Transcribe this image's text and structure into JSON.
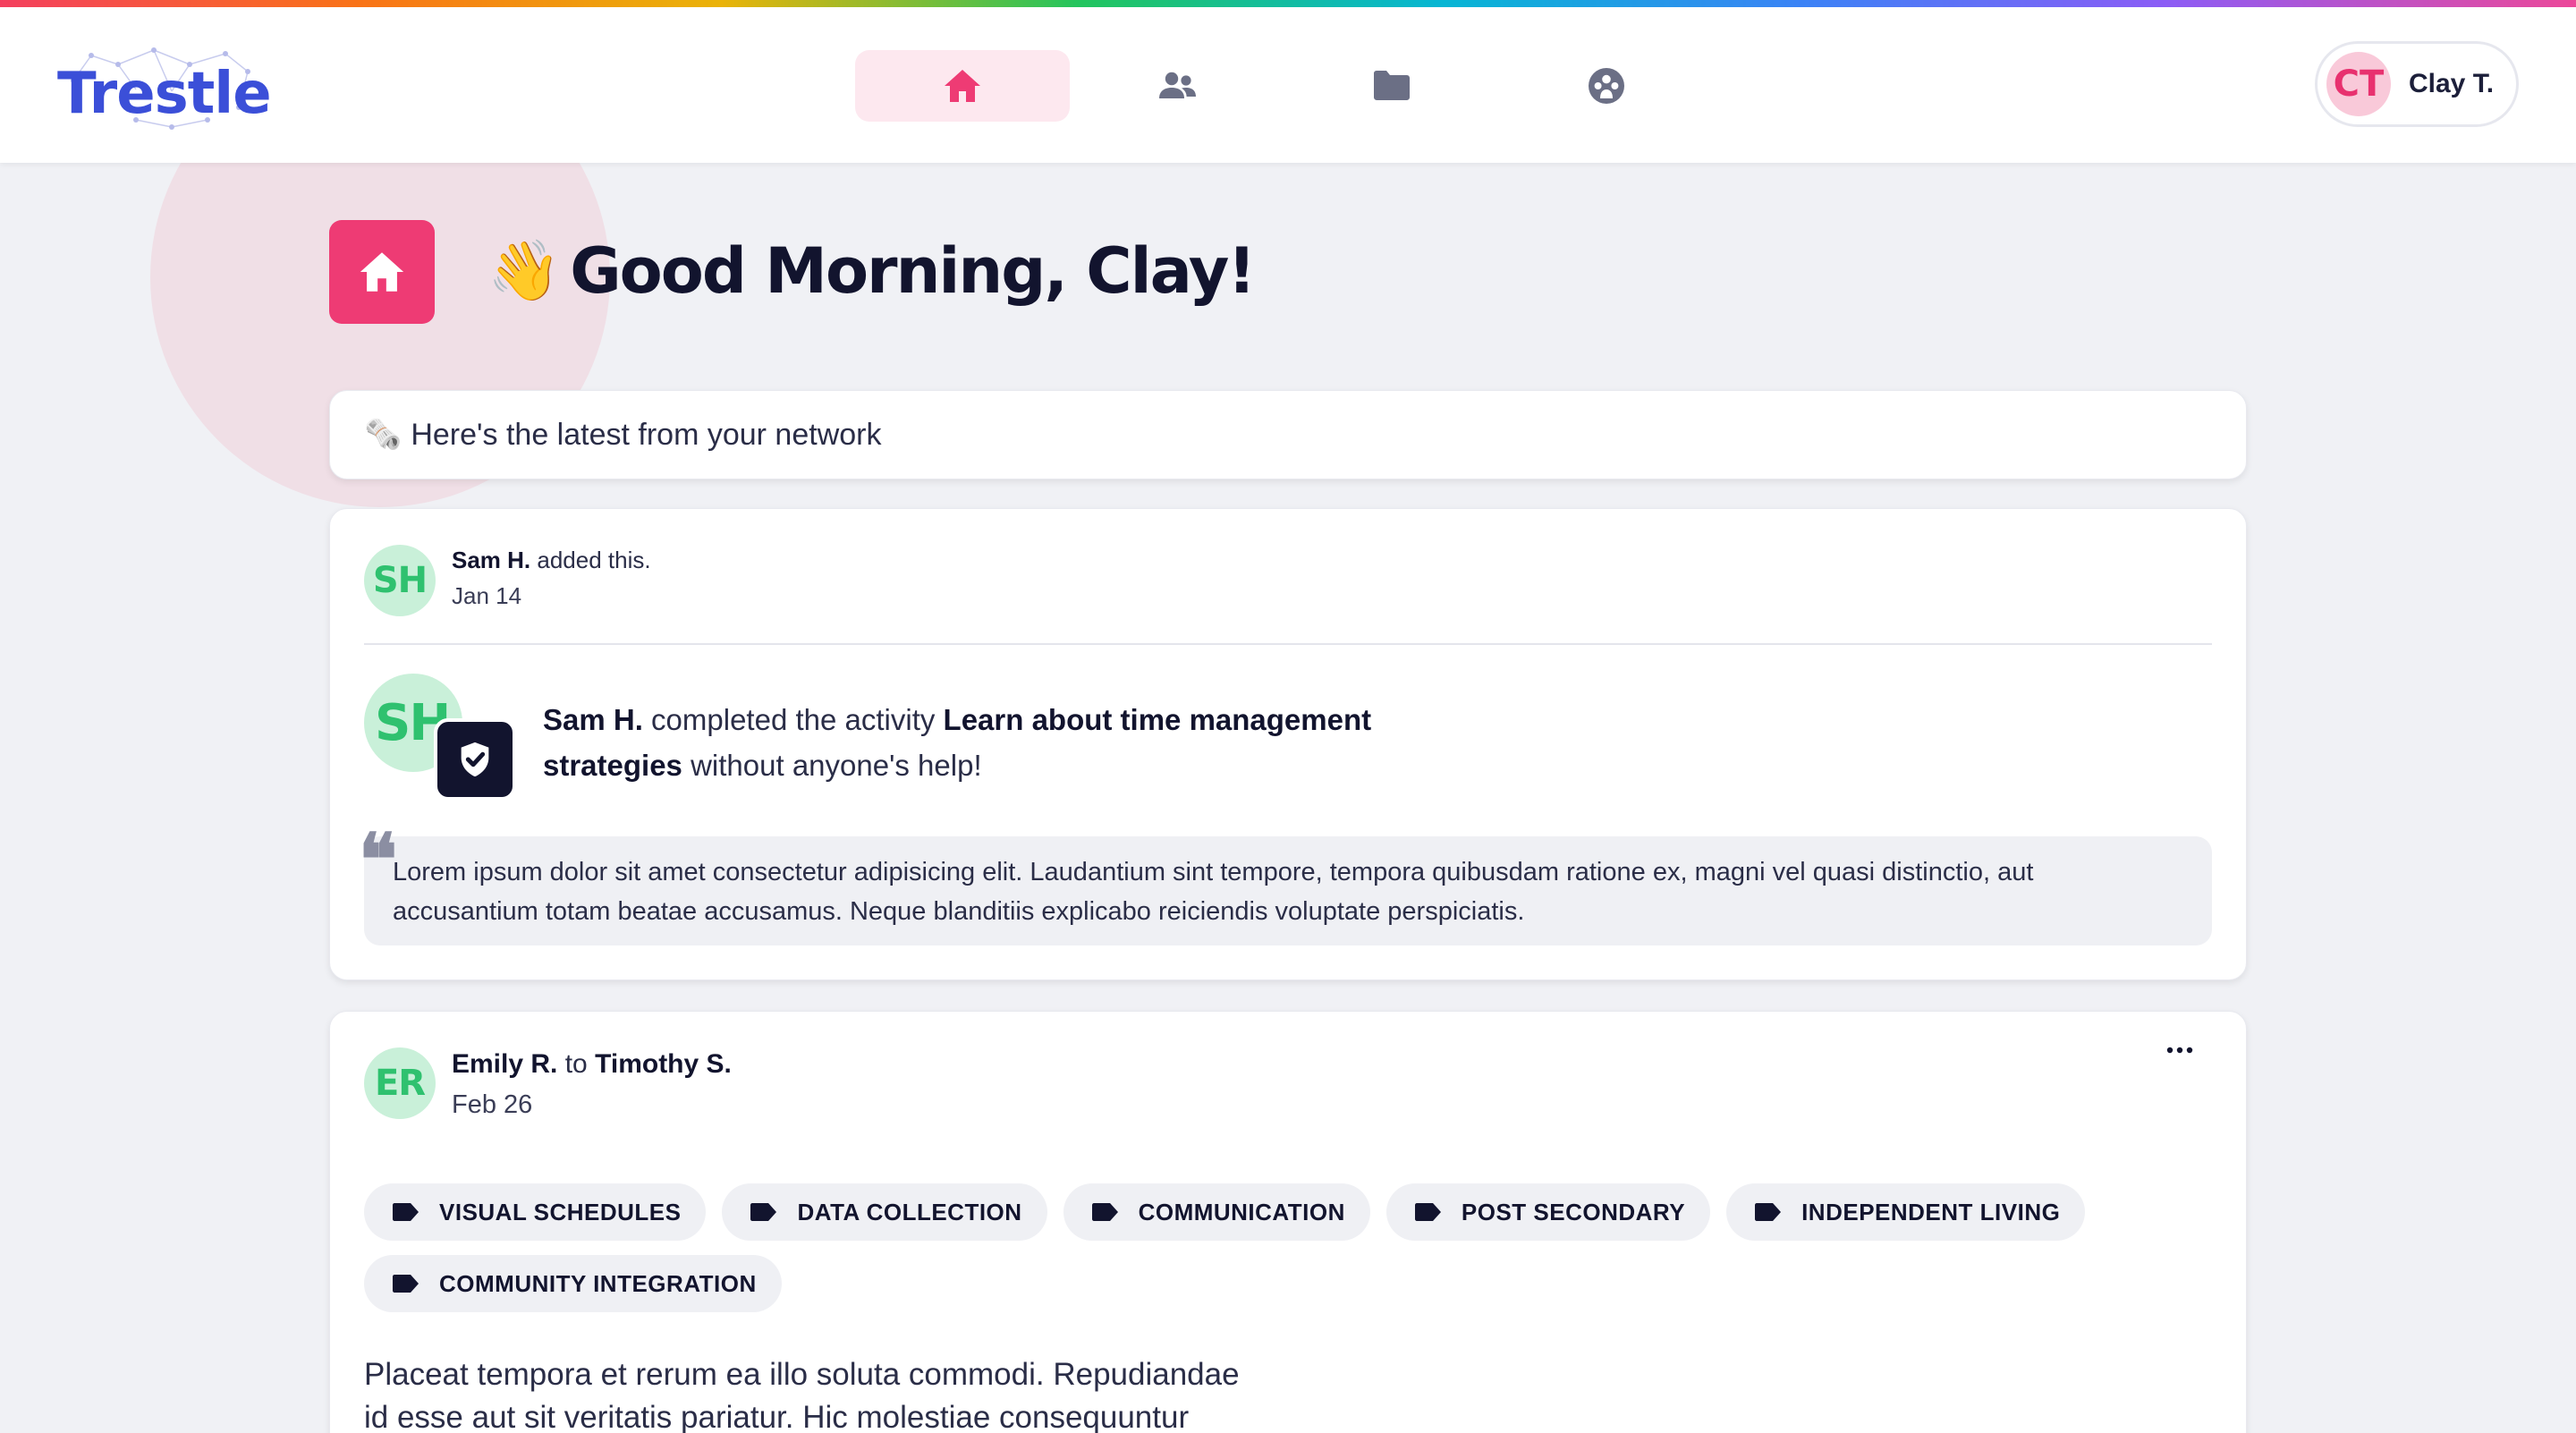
{
  "app": {
    "brand": "Trestle",
    "accent": "#ee3b74",
    "brand_color": "#3b4fd8"
  },
  "nav": {
    "items": [
      {
        "icon": "home-icon",
        "active": true
      },
      {
        "icon": "people-icon",
        "active": false
      },
      {
        "icon": "folder-icon",
        "active": false
      },
      {
        "icon": "community-icon",
        "active": false
      }
    ]
  },
  "user": {
    "initials": "CT",
    "name": "Clay T."
  },
  "header": {
    "wave_emoji": "👋",
    "greeting": "Good Morning, Clay!"
  },
  "feed": {
    "intro_emoji": "🗞️",
    "intro": "Here's the latest from your network"
  },
  "post1": {
    "initials": "SH",
    "author": "Sam H.",
    "action": " added this.",
    "date": "Jan 14",
    "activity_actor": "Sam H.",
    "activity_mid": " completed the activity ",
    "activity_title": "Learn about time management strategies",
    "activity_tail": " without anyone's help!",
    "quote_mark": "❝",
    "quote": "Lorem ipsum dolor sit amet consectetur adipisicing elit. Laudantium sint tempore, tempora quibusdam ratione ex, magni vel quasi distinctio, aut accusantium totam beatae accusamus. Neque blanditiis explicabo reiciendis voluptate perspiciatis."
  },
  "post2": {
    "initials": "ER",
    "author": "Emily R.",
    "to_word": " to ",
    "recipient": "Timothy S.",
    "date": "Feb 26",
    "tags": [
      "VISUAL SCHEDULES",
      "DATA COLLECTION",
      "COMMUNICATION",
      "POST SECONDARY",
      "INDEPENDENT LIVING",
      "COMMUNITY INTEGRATION"
    ],
    "body": "Placeat tempora et rerum ea illo soluta commodi. Repudiandae id esse aut sit veritatis pariatur. Hic molestiae consequuntur"
  }
}
